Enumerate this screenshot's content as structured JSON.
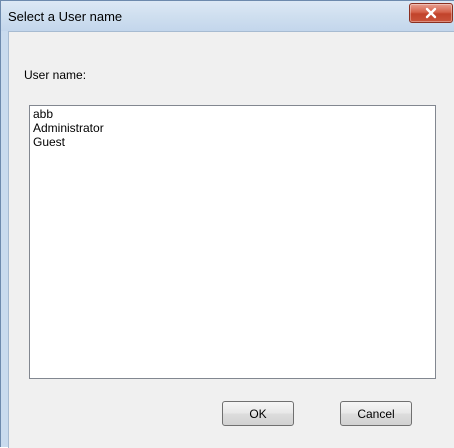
{
  "window": {
    "title": "Select a User name"
  },
  "form": {
    "username_label": "User name:",
    "users": [
      "abb",
      "Administrator",
      "Guest"
    ]
  },
  "buttons": {
    "ok_label": "OK",
    "cancel_label": "Cancel"
  },
  "icons": {
    "close": "close-icon"
  },
  "colors": {
    "close_button": "#c9533a",
    "title_bar": "#cfdfef",
    "dialog_background": "#f0f0f0"
  }
}
